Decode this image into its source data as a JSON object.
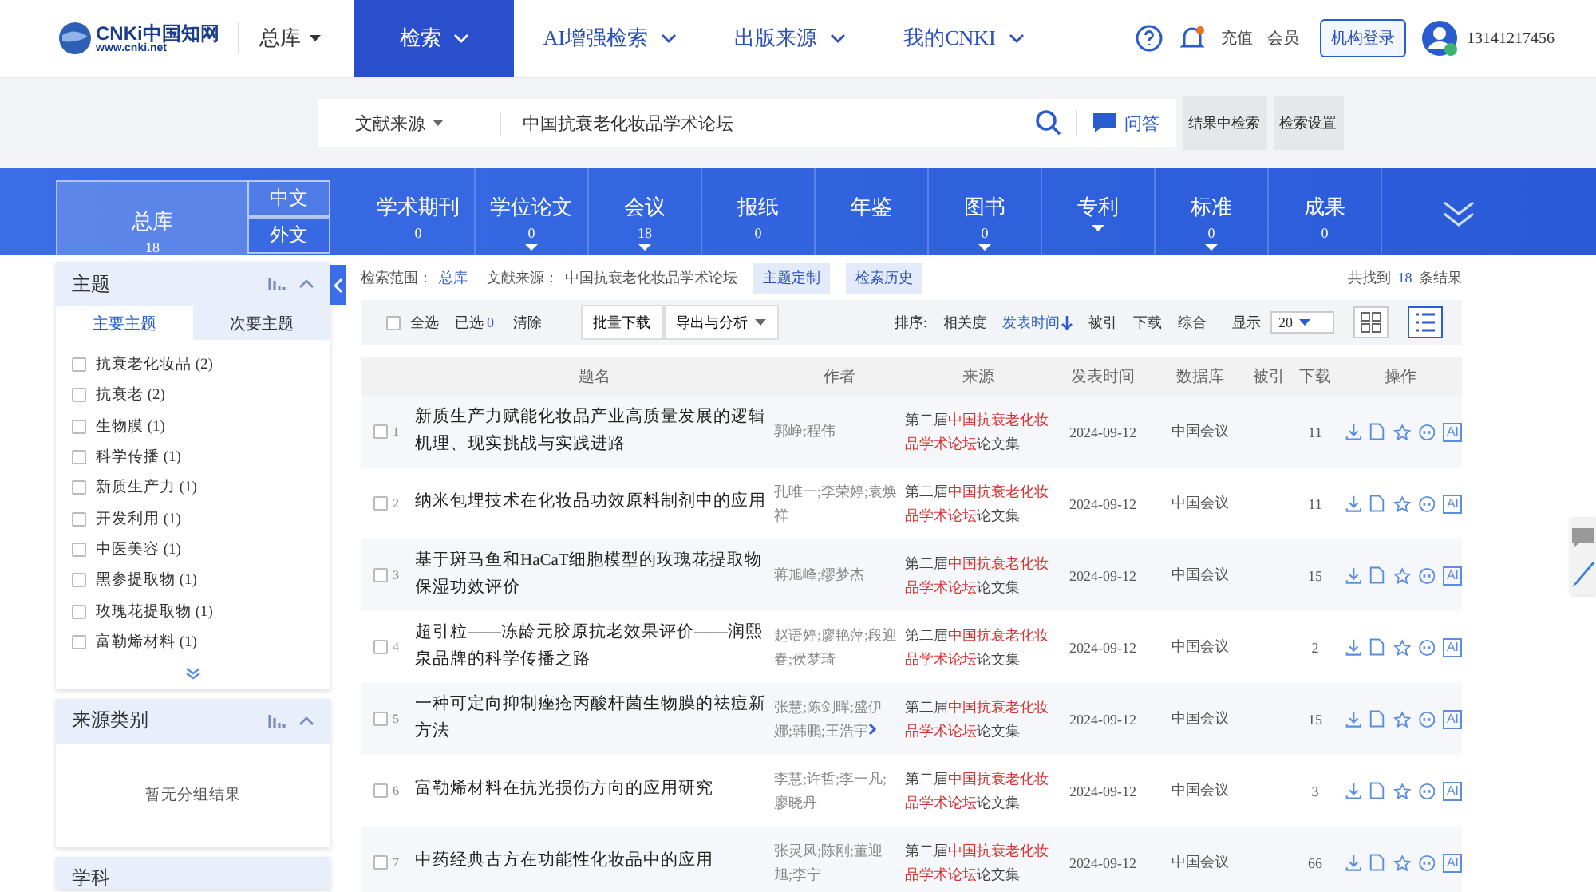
{
  "header": {
    "logo_main": "CNKi中国知网",
    "logo_url": "www.cnki.net",
    "library": "总库",
    "nav": [
      {
        "label": "检索",
        "selected": true
      },
      {
        "label": "AI增强检索",
        "selected": false
      },
      {
        "label": "出版来源",
        "selected": false
      },
      {
        "label": "我的CNKI",
        "selected": false
      }
    ],
    "links": [
      "充值",
      "会员"
    ],
    "login": "机构登录",
    "user": "13141217456"
  },
  "search": {
    "field": "文献来源",
    "value": "中国抗衰老化妆品学术论坛",
    "ask": "问答",
    "buttons": [
      "结果中检索",
      "检索设置"
    ]
  },
  "categories": [
    {
      "label": "总库",
      "count": "18",
      "selected": true,
      "dropdown": false
    },
    {
      "label": "学术期刊",
      "count": "0",
      "selected": false,
      "dropdown": false
    },
    {
      "label": "学位论文",
      "count": "0",
      "selected": false,
      "dropdown": true
    },
    {
      "label": "会议",
      "count": "18",
      "selected": false,
      "dropdown": true
    },
    {
      "label": "报纸",
      "count": "0",
      "selected": false,
      "dropdown": false
    },
    {
      "label": "年鉴",
      "selected": false,
      "dropdown": false
    },
    {
      "label": "图书",
      "count": "0",
      "selected": false,
      "dropdown": true
    },
    {
      "label": "专利",
      "selected": false,
      "dropdown": true
    },
    {
      "label": "标准",
      "count": "0",
      "selected": false,
      "dropdown": true
    },
    {
      "label": "成果",
      "count": "0",
      "selected": false,
      "dropdown": false
    }
  ],
  "languages": [
    {
      "label": "中文",
      "selected": true
    },
    {
      "label": "外文",
      "selected": false
    }
  ],
  "sidebar": {
    "topic": {
      "title": "主题",
      "tabs": [
        {
          "label": "主要主题",
          "selected": true
        },
        {
          "label": "次要主题",
          "selected": false
        }
      ],
      "items": [
        {
          "label": "抗衰老化妆品 (2)",
          "checked": false
        },
        {
          "label": "抗衰老 (2)",
          "checked": false
        },
        {
          "label": "生物膜 (1)",
          "checked": false
        },
        {
          "label": "科学传播 (1)",
          "checked": false
        },
        {
          "label": "新质生产力 (1)",
          "checked": false
        },
        {
          "label": "开发利用 (1)",
          "checked": false
        },
        {
          "label": "中医美容 (1)",
          "checked": false
        },
        {
          "label": "黑参提取物 (1)",
          "checked": false
        },
        {
          "label": "玫瑰花提取物 (1)",
          "checked": false
        },
        {
          "label": "富勒烯材料 (1)",
          "checked": false
        }
      ]
    },
    "source": {
      "title": "来源类别",
      "empty": "暂无分组结果"
    },
    "subject": {
      "title": "学科"
    }
  },
  "scope": {
    "label": "检索范围：",
    "scope": "总库",
    "source_label": "文献来源：",
    "source": "中国抗衰老化妆品学术论坛",
    "buttons": [
      "主题定制",
      "检索历史"
    ],
    "found_prefix": "共找到",
    "found": "18",
    "found_suffix": "条结果"
  },
  "toolbar": {
    "select_all_checked": false,
    "select_all": "全选",
    "selected_label": "已选",
    "selected_count": "0",
    "clear": "清除",
    "batch": "批量下载",
    "export": "导出与分析",
    "sort_label": "排序:",
    "sorts": [
      {
        "label": "相关度",
        "selected": false
      },
      {
        "label": "发表时间",
        "selected": true
      },
      {
        "label": "被引",
        "selected": false
      },
      {
        "label": "下载",
        "selected": false
      },
      {
        "label": "综合",
        "selected": false
      }
    ],
    "show_label": "显示",
    "page_size": "20",
    "views": [
      {
        "kind": "grid",
        "selected": false
      },
      {
        "kind": "list",
        "selected": true
      }
    ]
  },
  "table": {
    "columns": [
      "题名",
      "作者",
      "来源",
      "发表时间",
      "数据库",
      "被引",
      "下载",
      "操作"
    ],
    "rows": [
      {
        "num": "1",
        "title": "新质生产力赋能化妆品产业高质量发展的逻辑机理、现实挑战与实践进路",
        "authors": "郭峥;程伟",
        "more": false,
        "src_pre": "第二届",
        "src_hit": "中国抗衰老化妆品学术论坛",
        "src_post": "论文集",
        "date": "2024-09-12",
        "db": "中国会议",
        "downloads": "11",
        "ai": "AI",
        "checked": false
      },
      {
        "num": "2",
        "title": "纳米包埋技术在化妆品功效原料制剂中的应用",
        "authors": "孔唯一;李荣婷;袁焕祥",
        "more": false,
        "src_pre": "第二届",
        "src_hit": "中国抗衰老化妆品学术论坛",
        "src_post": "论文集",
        "date": "2024-09-12",
        "db": "中国会议",
        "downloads": "11",
        "ai": "AI",
        "checked": false
      },
      {
        "num": "3",
        "title": "基于斑马鱼和HaCaT细胞模型的玫瑰花提取物保湿功效评价",
        "authors": "蒋旭峰;缪梦杰",
        "more": false,
        "src_pre": "第二届",
        "src_hit": "中国抗衰老化妆品学术论坛",
        "src_post": "论文集",
        "date": "2024-09-12",
        "db": "中国会议",
        "downloads": "15",
        "ai": "AI",
        "checked": false
      },
      {
        "num": "4",
        "title": "超引粒——冻龄元胶原抗老效果评价——润熙泉品牌的科学传播之路",
        "authors": "赵语婷;廖艳萍;段迎春;侯梦琦",
        "more": false,
        "src_pre": "第二届",
        "src_hit": "中国抗衰老化妆品学术论坛",
        "src_post": "论文集",
        "date": "2024-09-12",
        "db": "中国会议",
        "downloads": "2",
        "ai": "AI",
        "checked": false
      },
      {
        "num": "5",
        "title": "一种可定向抑制痤疮丙酸杆菌生物膜的祛痘新方法",
        "authors": "张慧;陈剑晖;盛伊娜;韩鹏;王浩宇",
        "more": true,
        "src_pre": "第二届",
        "src_hit": "中国抗衰老化妆品学术论坛",
        "src_post": "论文集",
        "date": "2024-09-12",
        "db": "中国会议",
        "downloads": "15",
        "ai": "AI",
        "checked": false
      },
      {
        "num": "6",
        "title": "富勒烯材料在抗光损伤方向的应用研究",
        "authors": "李慧;许哲;李一凡;廖晓丹",
        "more": false,
        "src_pre": "第二届",
        "src_hit": "中国抗衰老化妆品学术论坛",
        "src_post": "论文集",
        "date": "2024-09-12",
        "db": "中国会议",
        "downloads": "3",
        "ai": "AI",
        "checked": false
      },
      {
        "num": "7",
        "title": "中药经典古方在功能性化妆品中的应用",
        "authors": "张灵凤;陈刚;董迎旭;李宁",
        "more": false,
        "src_pre": "第二届",
        "src_hit": "中国抗衰老化妆品学术论坛",
        "src_post": "论文集",
        "date": "2024-09-12",
        "db": "中国会议",
        "downloads": "66",
        "ai": "AI",
        "checked": false
      }
    ]
  }
}
